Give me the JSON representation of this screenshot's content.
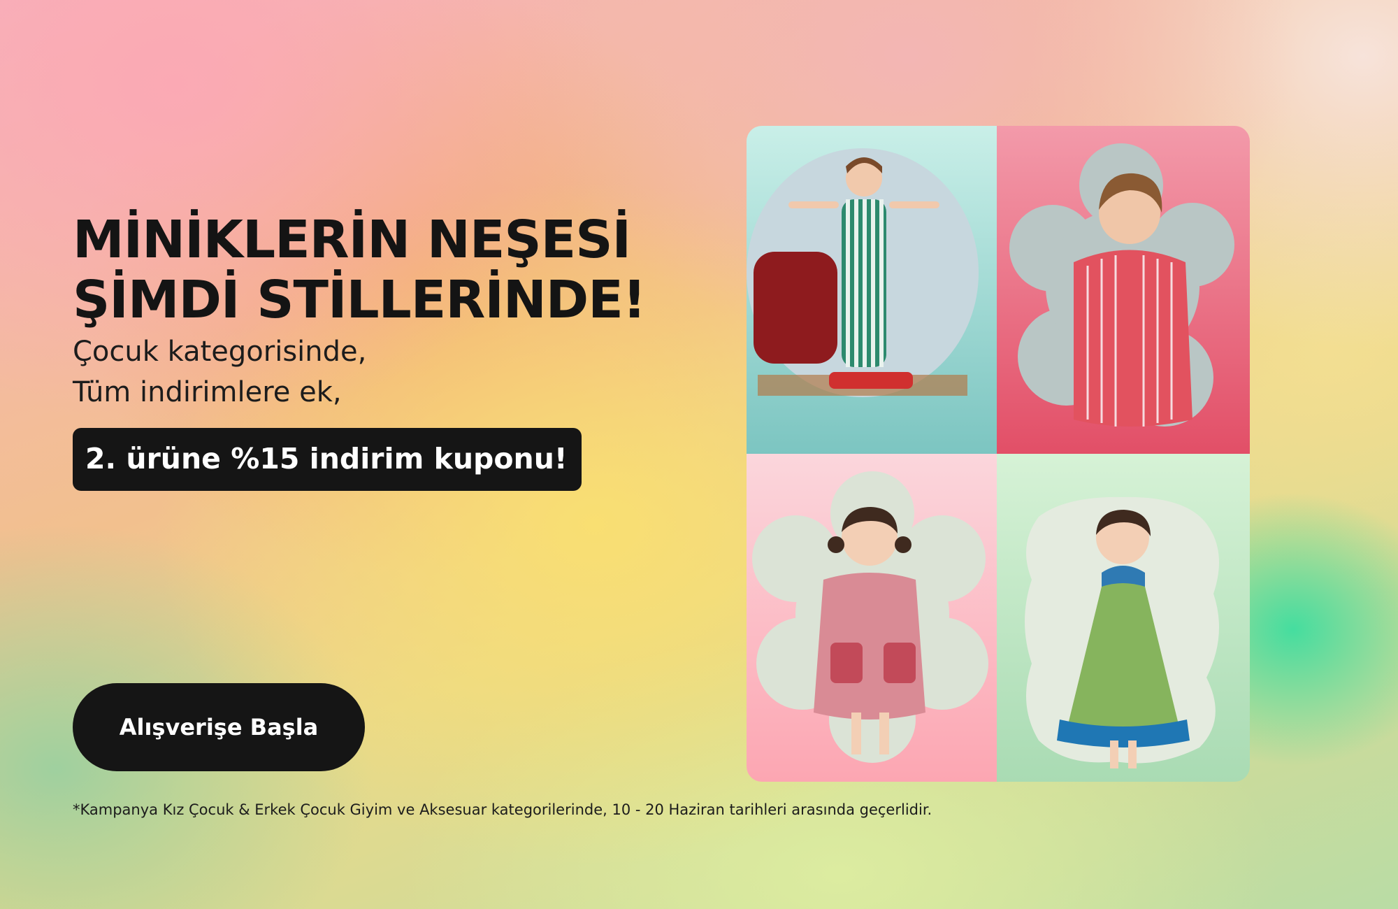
{
  "hero": {
    "headline_line1": "MİNİKLERİN NEŞESİ",
    "headline_line2": "ŞİMDİ STİLLERİNDE!",
    "subline1": "Çocuk kategorisinde,",
    "subline2": "Tüm indirimlere ek,",
    "coupon": "2. ürüne %15 indirim kuponu!",
    "cta_label": "Alışverişe Başla",
    "footnote": "*Kampanya Kız Çocuk & Erkek Çocuk Giyim ve Aksesuar kategorilerinde, 10 - 20 Haziran tarihleri arasında geçerlidir."
  },
  "colors": {
    "text_dark": "#141414",
    "button_bg": "#151515",
    "tile_teal": "#7cc5c1",
    "tile_red": "#e24f67",
    "tile_pink": "#fca6b2",
    "tile_green": "#a9dbb3"
  }
}
